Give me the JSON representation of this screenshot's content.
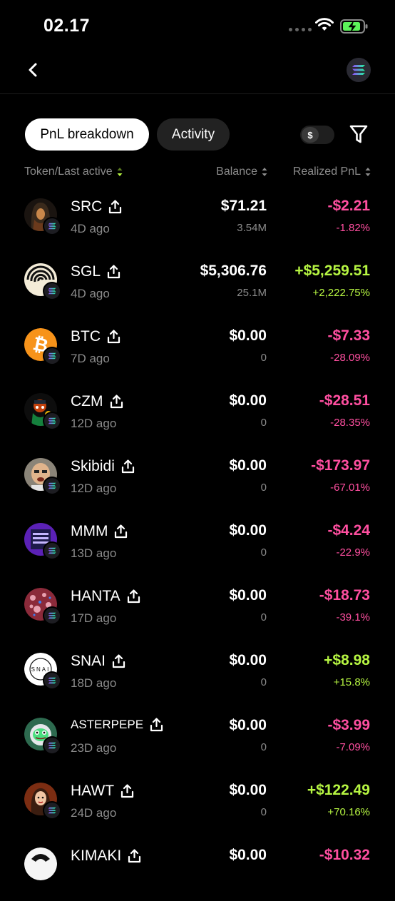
{
  "status_bar": {
    "time": "02.17"
  },
  "tabs": {
    "pnl_breakdown": "PnL breakdown",
    "activity": "Activity"
  },
  "currency_toggle": {
    "symbol": "$"
  },
  "columns": {
    "token": "Token/Last active",
    "balance": "Balance",
    "pnl": "Realized PnL"
  },
  "colors": {
    "negative": "#ff4fa0",
    "positive": "#b6f542",
    "accent_sort": "#b6f542"
  },
  "tokens": [
    {
      "name": "SRC",
      "ago": "4D ago",
      "balance": "$71.21",
      "qty": "3.54M",
      "pnl": "-$2.21",
      "pnl_pct": "-1.82%",
      "sign": "neg",
      "avatar": "hooded-figure"
    },
    {
      "name": "SGL",
      "ago": "4D ago",
      "balance": "$5,306.76",
      "qty": "25.1M",
      "pnl": "+$5,259.51",
      "pnl_pct": "+2,222.75%",
      "sign": "pos",
      "avatar": "spiral"
    },
    {
      "name": "BTC",
      "ago": "7D ago",
      "balance": "$0.00",
      "qty": "0",
      "pnl": "-$7.33",
      "pnl_pct": "-28.09%",
      "sign": "neg",
      "avatar": "bitcoin"
    },
    {
      "name": "CZM",
      "ago": "12D ago",
      "balance": "$0.00",
      "qty": "0",
      "pnl": "-$28.51",
      "pnl_pct": "-28.35%",
      "sign": "neg",
      "avatar": "cartoon"
    },
    {
      "name": "Skibidi",
      "ago": "12D ago",
      "balance": "$0.00",
      "qty": "0",
      "pnl": "-$173.97",
      "pnl_pct": "-67.01%",
      "sign": "neg",
      "avatar": "head"
    },
    {
      "name": "MMM",
      "ago": "13D ago",
      "balance": "$0.00",
      "qty": "0",
      "pnl": "-$4.24",
      "pnl_pct": "-22.9%",
      "sign": "neg",
      "avatar": "purple-box"
    },
    {
      "name": "HANTA",
      "ago": "17D ago",
      "balance": "$0.00",
      "qty": "0",
      "pnl": "-$18.73",
      "pnl_pct": "-39.1%",
      "sign": "neg",
      "avatar": "virus"
    },
    {
      "name": "SNAI",
      "ago": "18D ago",
      "balance": "$0.00",
      "qty": "0",
      "pnl": "+$8.98",
      "pnl_pct": "+15.8%",
      "sign": "pos",
      "avatar": "snai-logo",
      "avatar_text": "SNAI"
    },
    {
      "name": "ASTERPEPE",
      "ago": "23D ago",
      "balance": "$0.00",
      "qty": "0",
      "pnl": "-$3.99",
      "pnl_pct": "-7.09%",
      "sign": "neg",
      "avatar": "pepe-astronaut"
    },
    {
      "name": "HAWT",
      "ago": "24D ago",
      "balance": "$0.00",
      "qty": "0",
      "pnl": "+$122.49",
      "pnl_pct": "+70.16%",
      "sign": "pos",
      "avatar": "woman"
    },
    {
      "name": "KIMAKI",
      "ago": "",
      "balance": "$0.00",
      "qty": "",
      "pnl": "-$10.32",
      "pnl_pct": "",
      "sign": "neg",
      "avatar": "partial"
    }
  ]
}
